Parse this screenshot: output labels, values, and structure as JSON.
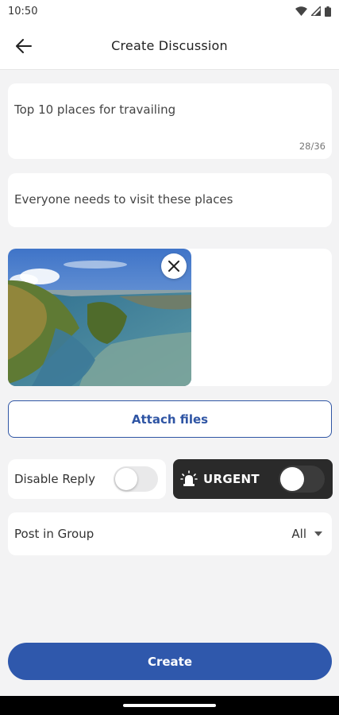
{
  "status_bar": {
    "time": "10:50"
  },
  "header": {
    "title": "Create Discussion"
  },
  "title_field": {
    "value": "Top 10 places for travailing",
    "counter": "28/36"
  },
  "description_field": {
    "value": "Everyone needs to visit these places"
  },
  "attachment": {
    "image": "river-landscape-photo"
  },
  "attach_button": {
    "label": "Attach files"
  },
  "disable_reply": {
    "label": "Disable Reply",
    "enabled": false
  },
  "urgent": {
    "label": "URGENT",
    "enabled": false
  },
  "group": {
    "label": "Post in Group",
    "value": "All"
  },
  "create_button": {
    "label": "Create"
  },
  "colors": {
    "primary": "#2f58ac",
    "urgent_bg": "#2a2a2a",
    "background": "#f3f3f4"
  }
}
